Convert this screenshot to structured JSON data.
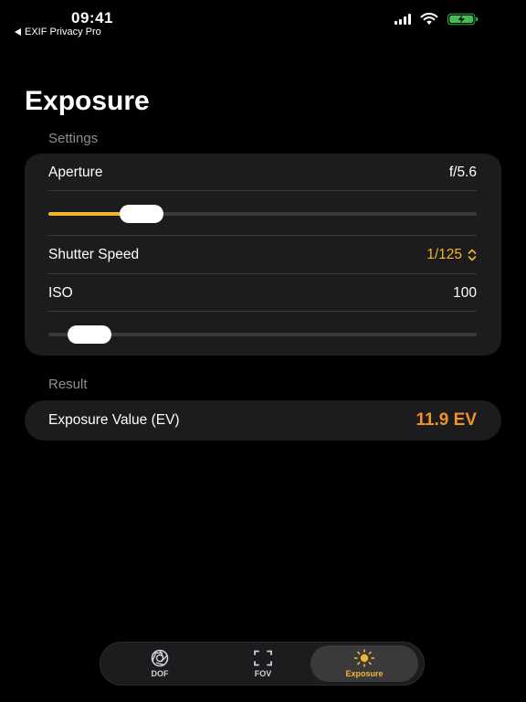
{
  "status_bar": {
    "time": "09:41",
    "back_app": "EXIF Privacy Pro"
  },
  "page": {
    "title": "Exposure"
  },
  "settings": {
    "header": "Settings",
    "aperture": {
      "label": "Aperture",
      "value": "f/5.6",
      "slider_fraction": 0.185
    },
    "shutter": {
      "label": "Shutter Speed",
      "value": "1/125"
    },
    "iso": {
      "label": "ISO",
      "value": "100",
      "slider_fraction": 0.05
    }
  },
  "result": {
    "header": "Result",
    "ev_label": "Exposure Value (EV)",
    "ev_value": "11.9 EV"
  },
  "tabs": [
    {
      "label": "DOF",
      "icon": "aperture-icon",
      "active": false
    },
    {
      "label": "FOV",
      "icon": "viewfinder-icon",
      "active": false
    },
    {
      "label": "Exposure",
      "icon": "sun-icon",
      "active": true
    }
  ],
  "colors": {
    "accent": "#f5b528",
    "ev_accent": "#f0912a",
    "card": "#1c1c1e",
    "background": "#000000"
  }
}
